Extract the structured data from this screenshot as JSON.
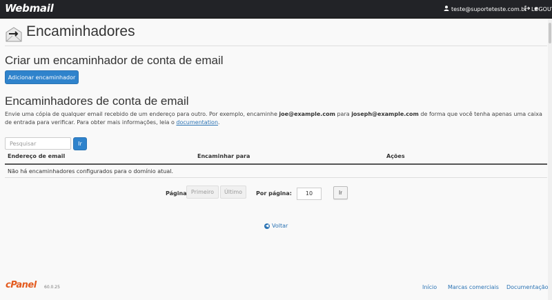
{
  "header": {
    "logo": "Webmail",
    "user_email": "teste@suporteteste.com.br",
    "logout": "LOGOUT"
  },
  "page": {
    "title": "Encaminhadores"
  },
  "create_section": {
    "heading": "Criar um encaminhador de conta de email",
    "add_button": "Adicionar encaminhador"
  },
  "list_section": {
    "heading": "Encaminhadores de conta de email",
    "desc_part1": "Envie uma cópia de qualquer email recebido de um endereço para outro. Por exemplo, encaminhe ",
    "desc_bold1": "joe@example.com",
    "desc_part2": " para ",
    "desc_bold2": "joseph@example.com",
    "desc_part3": " de forma que você tenha apenas uma caixa de entrada para verificar. Para obter mais informações, leia o ",
    "desc_link": "documentation",
    "desc_end": ".",
    "search_placeholder": "Pesquisar",
    "search_button": "Ir"
  },
  "table": {
    "columns": [
      "Endereço de email",
      "Encaminhar para",
      "Ações"
    ],
    "empty_message": "Não há encaminhadores configurados para o domínio atual."
  },
  "pagination": {
    "page_label": "Página:",
    "first": "Primeiro",
    "last": "Último",
    "per_page_label": "Por página:",
    "per_page_value": "10",
    "go_button": "Ir"
  },
  "back_link": "Voltar",
  "footer": {
    "logo": "cPanel",
    "version": "60.0.25",
    "links": [
      "Início",
      "Marcas comerciais",
      "Documentação"
    ]
  },
  "colors": {
    "topbar": "#222327",
    "primary": "#2f83cc",
    "link": "#2a73b4",
    "cpanel_orange": "#e35b1f"
  }
}
